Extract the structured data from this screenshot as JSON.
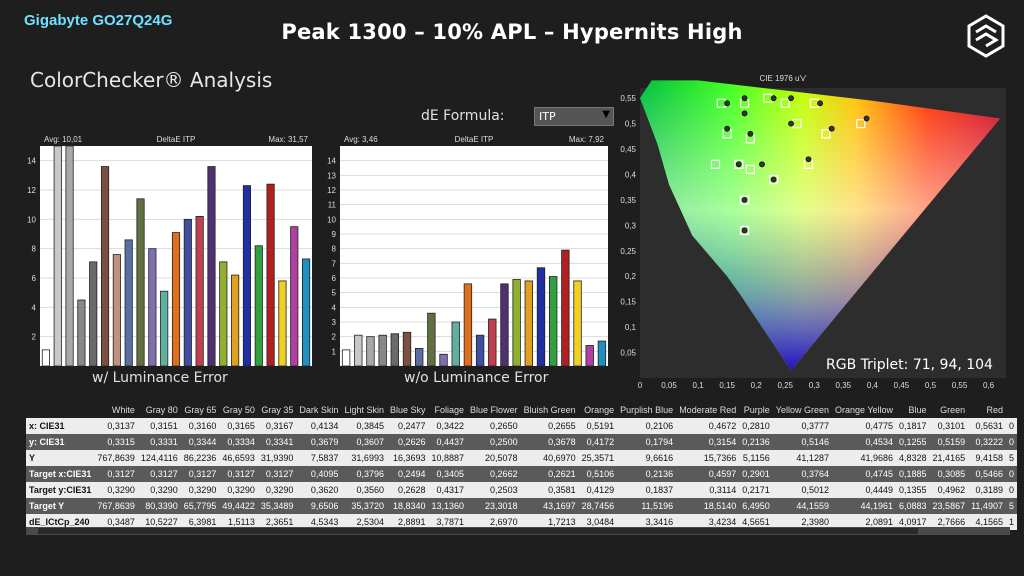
{
  "header": {
    "brand": "Gigabyte GO27Q24G",
    "title": "Peak 1300 – 10% APL – Hypernits High",
    "section_title": "ColorChecker® Analysis",
    "de_label": "dE Formula:",
    "de_value": "ITP",
    "rgb_triplet": "RGB Triplet: 71, 94, 104"
  },
  "colors": {
    "background": "#1e1e1e",
    "brand": "#6fe0ff"
  },
  "chart_data": [
    {
      "type": "bar",
      "title": "DeltaE ITP",
      "avg_label": "Avg: 10,01",
      "max_label": "Max: 31,57",
      "caption": "w/ Luminance Error",
      "ylim": [
        0,
        15
      ],
      "yticks": [
        2,
        4,
        6,
        8,
        10,
        12,
        14
      ],
      "values": [
        1.1,
        31.6,
        15.2,
        4.5,
        7.1,
        13.6,
        7.6,
        8.6,
        11.4,
        8.0,
        5.1,
        9.1,
        10.0,
        10.2,
        13.6,
        7.1,
        6.2,
        12.3,
        8.2,
        12.4,
        5.8,
        9.5,
        7.3
      ],
      "colors": [
        "#ffffff",
        "#c8c8c8",
        "#a8a8a8",
        "#888888",
        "#6a6a6a",
        "#7a5040",
        "#c09080",
        "#5870a0",
        "#607040",
        "#8070b0",
        "#60b0a0",
        "#e07020",
        "#4050a0",
        "#c04050",
        "#503070",
        "#90b030",
        "#e0a020",
        "#2030a0",
        "#30a040",
        "#b02020",
        "#f0d020",
        "#b040a0",
        "#2090c0"
      ]
    },
    {
      "type": "bar",
      "title": "DeltaE ITP",
      "avg_label": "Avg: 3,46",
      "max_label": "Max: 7,92",
      "caption": "w/o Luminance Error",
      "ylim": [
        0,
        15
      ],
      "yticks": [
        1,
        2,
        3,
        4,
        5,
        6,
        7,
        8,
        9,
        10,
        11,
        12,
        13,
        14
      ],
      "values": [
        1.1,
        2.1,
        2.0,
        2.1,
        2.2,
        2.3,
        1.2,
        3.6,
        0.8,
        3.0,
        5.6,
        2.1,
        3.2,
        5.6,
        5.9,
        5.8,
        6.7,
        6.1,
        7.9,
        5.8,
        1.4,
        1.7
      ],
      "colors": [
        "#ffffff",
        "#c8c8c8",
        "#a8a8a8",
        "#888888",
        "#6a6a6a",
        "#7a5040",
        "#5870a0",
        "#607040",
        "#8070b0",
        "#60b0a0",
        "#e07020",
        "#4050a0",
        "#c04050",
        "#503070",
        "#90b030",
        "#e0a020",
        "#2030a0",
        "#30a040",
        "#b02020",
        "#f0d020",
        "#b040a0",
        "#2090c0"
      ]
    },
    {
      "type": "scatter",
      "title": "CIE 1976 u'v'",
      "xlim": [
        0,
        0.63
      ],
      "ylim": [
        0,
        0.57
      ],
      "xticks": [
        "0",
        "0,05",
        "0,1",
        "0,15",
        "0,2",
        "0,25",
        "0,3",
        "0,35",
        "0,4",
        "0,45",
        "0,5",
        "0,55",
        "0,6"
      ],
      "yticks": [
        "0,05",
        "0,1",
        "0,15",
        "0,2",
        "0,25",
        "0,3",
        "0,35",
        "0,4",
        "0,45",
        "0,5",
        "0,55"
      ],
      "targets": [
        [
          0.14,
          0.54
        ],
        [
          0.18,
          0.54
        ],
        [
          0.22,
          0.55
        ],
        [
          0.25,
          0.54
        ],
        [
          0.3,
          0.54
        ],
        [
          0.15,
          0.48
        ],
        [
          0.19,
          0.47
        ],
        [
          0.27,
          0.5
        ],
        [
          0.32,
          0.48
        ],
        [
          0.38,
          0.5
        ],
        [
          0.13,
          0.42
        ],
        [
          0.17,
          0.42
        ],
        [
          0.19,
          0.41
        ],
        [
          0.23,
          0.39
        ],
        [
          0.29,
          0.42
        ],
        [
          0.18,
          0.35
        ],
        [
          0.18,
          0.29
        ]
      ],
      "measured": [
        [
          0.15,
          0.54
        ],
        [
          0.18,
          0.55
        ],
        [
          0.23,
          0.55
        ],
        [
          0.26,
          0.55
        ],
        [
          0.31,
          0.54
        ],
        [
          0.18,
          0.52
        ],
        [
          0.15,
          0.49
        ],
        [
          0.19,
          0.48
        ],
        [
          0.26,
          0.5
        ],
        [
          0.33,
          0.49
        ],
        [
          0.39,
          0.51
        ],
        [
          0.17,
          0.42
        ],
        [
          0.21,
          0.42
        ],
        [
          0.23,
          0.39
        ],
        [
          0.29,
          0.43
        ],
        [
          0.18,
          0.35
        ],
        [
          0.18,
          0.29
        ]
      ]
    }
  ],
  "table": {
    "headers": [
      "",
      "White",
      "Gray 80",
      "Gray 65",
      "Gray 50",
      "Gray 35",
      "Dark Skin",
      "Light Skin",
      "Blue Sky",
      "Foliage",
      "Blue Flower",
      "Bluish Green",
      "Orange",
      "Purplish Blue",
      "Moderate Red",
      "Purple",
      "Yellow Green",
      "Orange Yellow",
      "Blue",
      "Green",
      "Red",
      ""
    ],
    "rows": [
      {
        "label": "x: CIE31",
        "cells": [
          "0,3137",
          "0,3151",
          "0,3160",
          "0,3165",
          "0,3167",
          "0,4134",
          "0,3845",
          "0,2477",
          "0,3422",
          "0,2650",
          "0,2655",
          "0,5191",
          "0,2106",
          "0,4672",
          "0,2810",
          "0,3777",
          "0,4775",
          "0,1817",
          "0,3101",
          "0,5631",
          "0"
        ]
      },
      {
        "label": "y: CIE31",
        "cells": [
          "0,3315",
          "0,3331",
          "0,3344",
          "0,3334",
          "0,3341",
          "0,3679",
          "0,3607",
          "0,2626",
          "0,4437",
          "0,2500",
          "0,3678",
          "0,4172",
          "0,1794",
          "0,3154",
          "0,2136",
          "0,5146",
          "0,4534",
          "0,1255",
          "0,5159",
          "0,3222",
          "0"
        ]
      },
      {
        "label": "Y",
        "cells": [
          "767,8639",
          "124,4116",
          "86,2236",
          "46,6593",
          "31,9390",
          "7,5837",
          "31,6993",
          "16,3693",
          "10,8887",
          "20,5078",
          "40,6970",
          "25,3571",
          "9,6616",
          "15,7366",
          "5,1156",
          "41,1287",
          "41,9686",
          "4,8328",
          "21,4165",
          "9,4158",
          "5"
        ]
      },
      {
        "label": "Target x:CIE31",
        "cells": [
          "0,3127",
          "0,3127",
          "0,3127",
          "0,3127",
          "0,3127",
          "0,4095",
          "0,3796",
          "0,2494",
          "0,3405",
          "0,2662",
          "0,2621",
          "0,5106",
          "0,2136",
          "0,4597",
          "0,2901",
          "0,3764",
          "0,4745",
          "0,1885",
          "0,3085",
          "0,5466",
          "0"
        ]
      },
      {
        "label": "Target y:CIE31",
        "cells": [
          "0,3290",
          "0,3290",
          "0,3290",
          "0,3290",
          "0,3290",
          "0,3620",
          "0,3560",
          "0,2628",
          "0,4317",
          "0,2503",
          "0,3581",
          "0,4129",
          "0,1837",
          "0,3114",
          "0,2171",
          "0,5012",
          "0,4449",
          "0,1355",
          "0,4962",
          "0,3189",
          "0"
        ]
      },
      {
        "label": "Target Y",
        "cells": [
          "767,8639",
          "80,3390",
          "65,7795",
          "49,4422",
          "35,3489",
          "9,6506",
          "35,3720",
          "18,8340",
          "13,1360",
          "23,3018",
          "43,1697",
          "28,7456",
          "11,5196",
          "18,5140",
          "6,4950",
          "44,1559",
          "44,1961",
          "6,0883",
          "23,5867",
          "11,4907",
          "5"
        ]
      },
      {
        "label": "dE_ICtCp_240",
        "cells": [
          "0,3487",
          "10,5227",
          "6,3981",
          "1,5113",
          "2,3651",
          "4,5343",
          "2,5304",
          "2,8891",
          "3,7871",
          "2,6970",
          "1,7213",
          "3,0484",
          "3,3416",
          "3,4234",
          "4,5651",
          "2,3980",
          "2,0891",
          "4,0917",
          "2,7666",
          "4,1565",
          "1"
        ]
      }
    ]
  }
}
